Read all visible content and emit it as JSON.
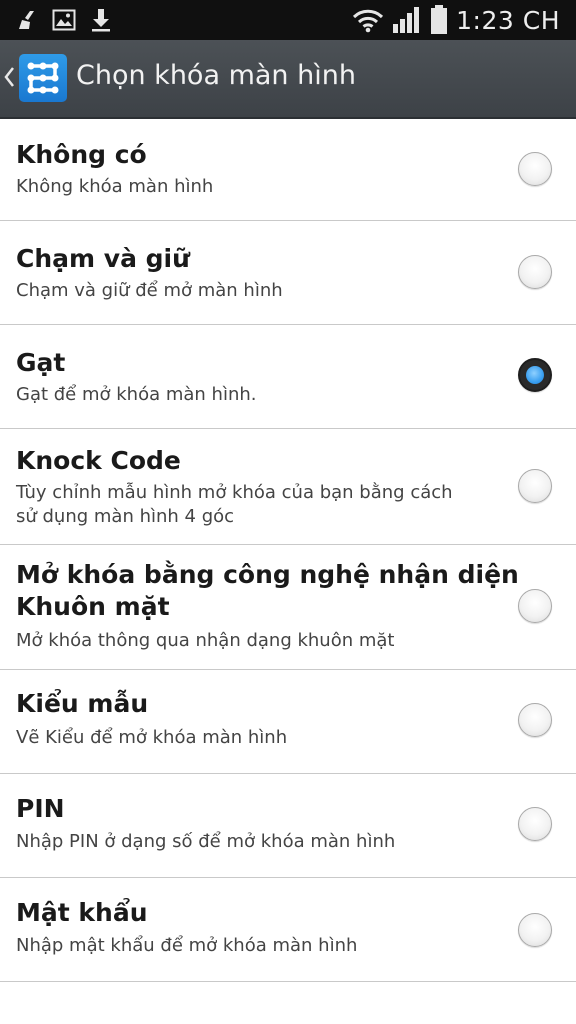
{
  "status_bar": {
    "time": "1:23 CH",
    "icons": [
      "cleaner-icon",
      "image-icon",
      "download-icon",
      "wifi-icon",
      "signal-icon",
      "battery-icon"
    ]
  },
  "action_bar": {
    "title": "Chọn khóa màn hình",
    "app_icon": "pattern-lock-icon",
    "accent_color": "#1a78d0"
  },
  "options": [
    {
      "title": "Không có",
      "subtitle": "Không khóa màn hình",
      "selected": false
    },
    {
      "title": "Chạm và giữ",
      "subtitle": "Chạm và giữ để mở màn hình",
      "selected": false
    },
    {
      "title": "Gạt",
      "subtitle": "Gạt để mở khóa màn hình.",
      "selected": true
    },
    {
      "title": "Knock Code",
      "subtitle_lines": [
        "Tùy chỉnh mẫu hình mở khóa của bạn bằng cách",
        "sử dụng màn hình 4 góc"
      ],
      "selected": false
    },
    {
      "title_lines": [
        "Mở khóa bằng công nghệ nhận diện",
        "Khuôn mặt"
      ],
      "subtitle": "Mở khóa thông qua nhận dạng khuôn mặt",
      "selected": false
    },
    {
      "title": "Kiểu mẫu",
      "subtitle": "Vẽ Kiểu để mở khóa màn hình",
      "selected": false
    },
    {
      "title": "PIN",
      "subtitle": "Nhập PIN ở dạng số để mở khóa màn hình",
      "selected": false
    },
    {
      "title": "Mật khẩu",
      "subtitle": "Nhập mật khẩu để mở khóa màn hình",
      "selected": false
    }
  ]
}
